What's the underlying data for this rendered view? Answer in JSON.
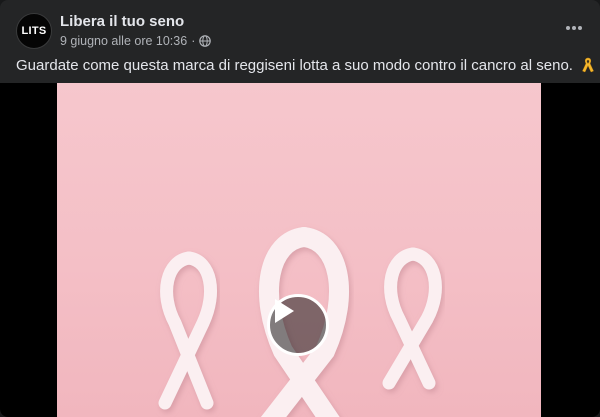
{
  "post": {
    "page_name": "Libera il tuo seno",
    "avatar_text": "LITS",
    "timestamp": "9 giugno alle ore 10:36",
    "separator": "·",
    "privacy_icon": "globe-icon",
    "more_icon": "more-horizontal-icon",
    "text": "Guardate come questa marca di reggiseni lotta a suo modo contro il cancro al seno.",
    "emoji_icon": "yellow-ribbon-icon"
  },
  "video": {
    "play_icon": "play-icon",
    "background_color": "#f4bfc6",
    "ribbon_color": "#fbeff1"
  },
  "colors": {
    "card_bg": "#242526",
    "text_primary": "#e4e6eb",
    "text_secondary": "#b0b3b8"
  }
}
